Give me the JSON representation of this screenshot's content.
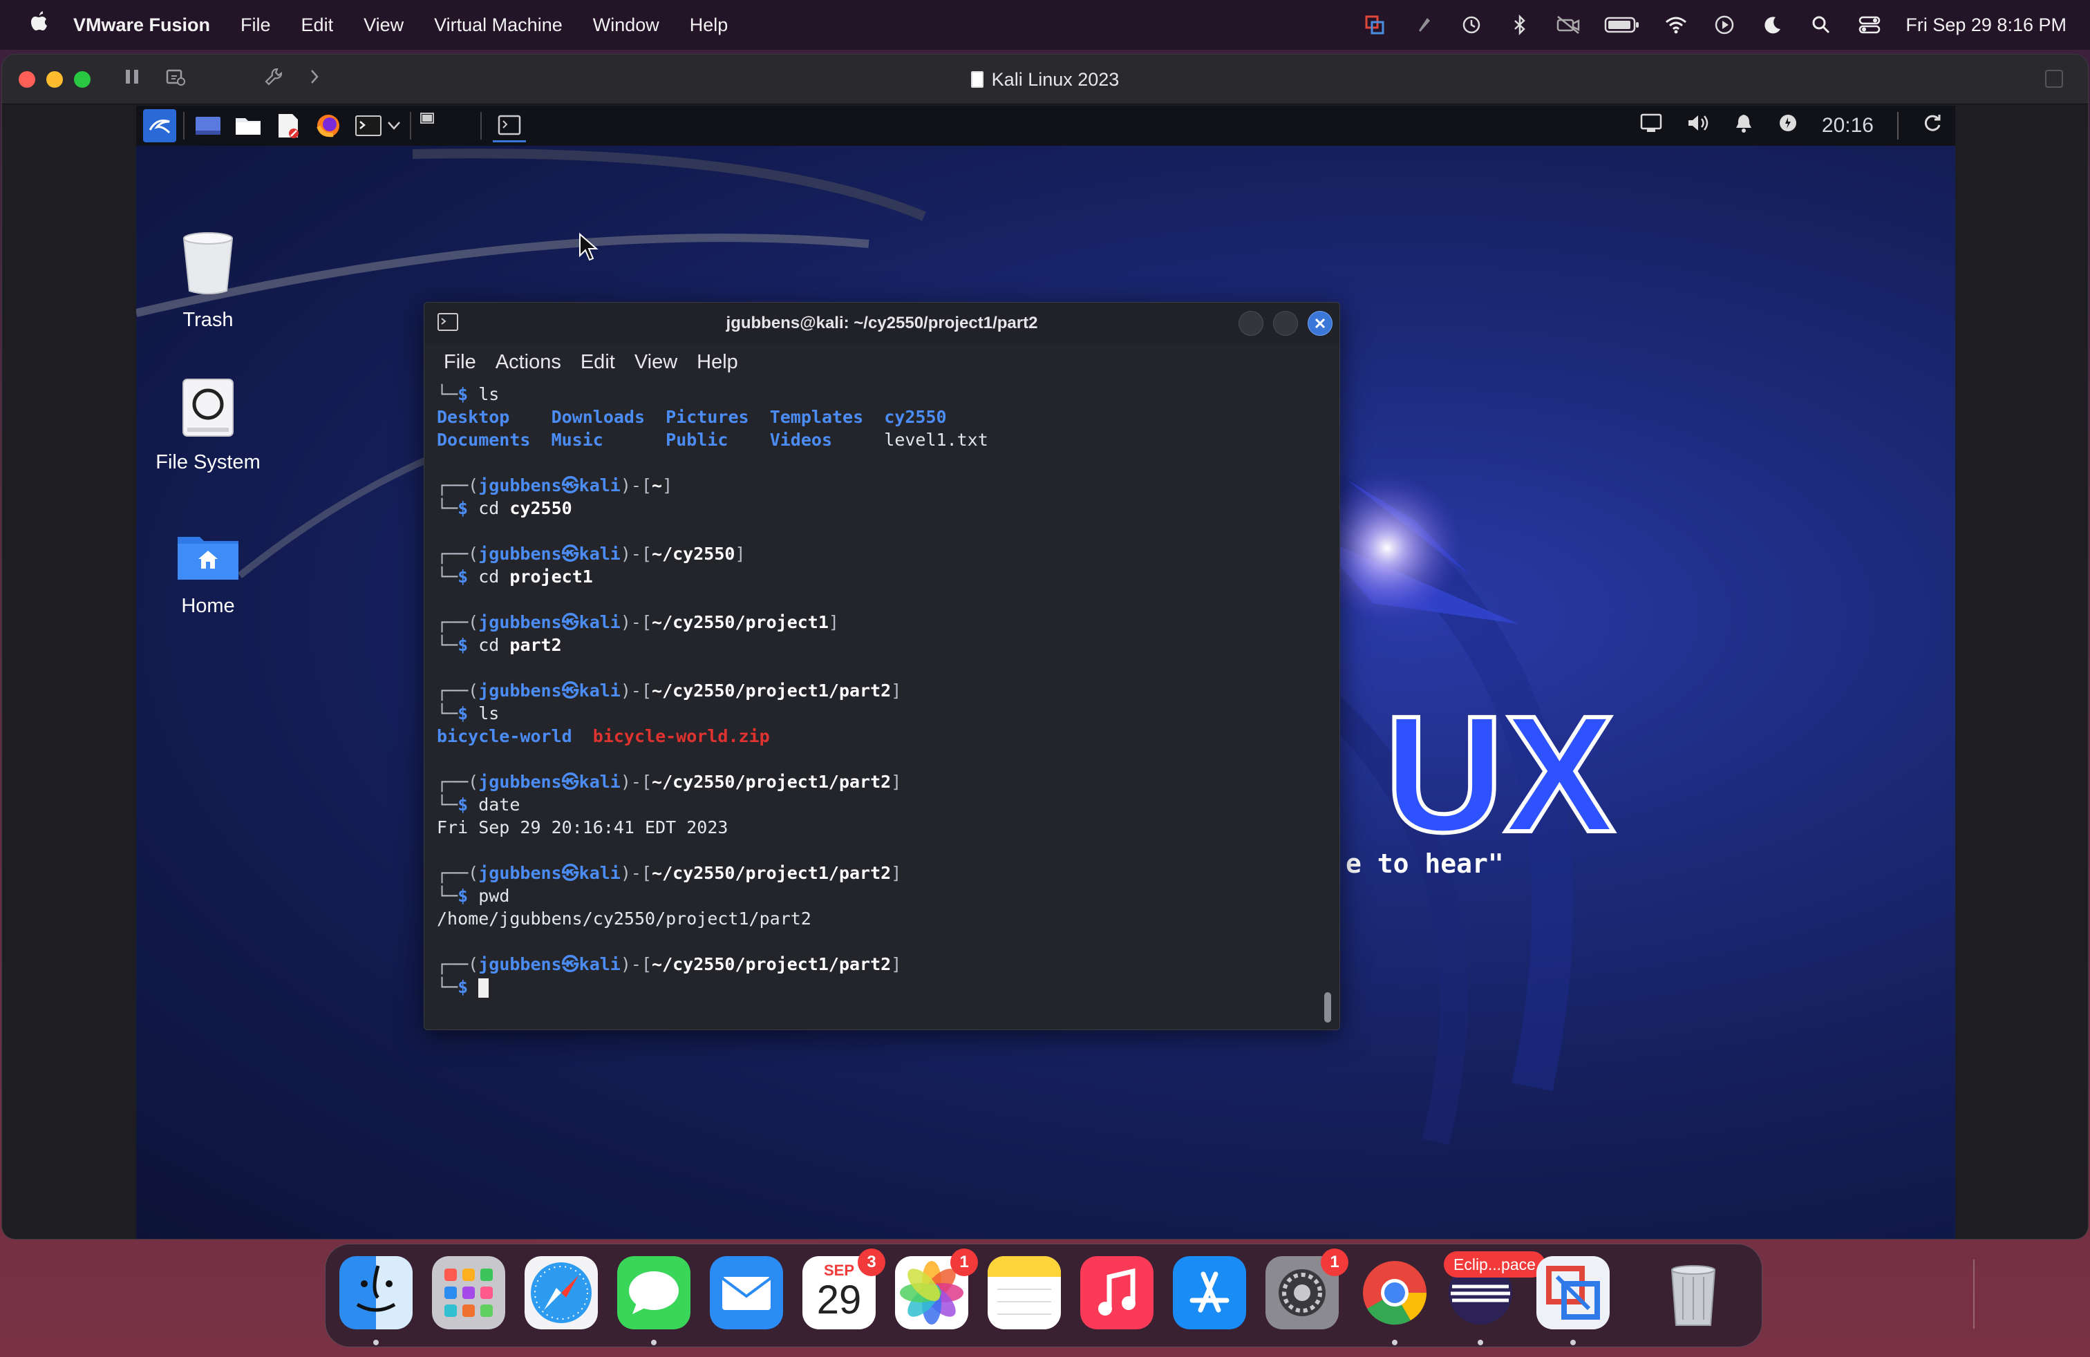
{
  "mac_menubar": {
    "app_name": "VMware Fusion",
    "menus": [
      "File",
      "Edit",
      "View",
      "Virtual Machine",
      "Window",
      "Help"
    ],
    "status_icons": [
      "vmware-status-icon",
      "rocket-icon",
      "time-machine-icon",
      "bluetooth-icon",
      "muted-camera-icon",
      "battery-icon",
      "wifi-icon",
      "now-playing-icon",
      "focus-moon-icon",
      "spotlight-search-icon",
      "control-center-icon"
    ],
    "clock": "Fri Sep 29  8:16 PM"
  },
  "vm_window": {
    "title": "Kali Linux 2023"
  },
  "guest": {
    "panel_clock": "20:16",
    "desktop_icons": [
      {
        "label": "Trash",
        "icon": "trash-icon"
      },
      {
        "label": "File System",
        "icon": "drive-icon"
      },
      {
        "label": "Home",
        "icon": "home-folder-icon"
      }
    ],
    "wallpaper_brand": "KALI LINUX",
    "wallpaper_brand_visible": "UX",
    "wallpaper_quote_visible": "e to hear\"",
    "wallpaper_quote_faded": "become, the more you are able to hear\""
  },
  "terminal": {
    "title": "jgubbens@kali: ~/cy2550/project1/part2",
    "menus": [
      "File",
      "Actions",
      "Edit",
      "View",
      "Help"
    ],
    "user": "jgubbens",
    "host": "kali",
    "first_cmd": "ls",
    "ls_home": [
      [
        "Desktop",
        "Downloads",
        "Pictures",
        "Templates",
        "cy2550"
      ],
      [
        "Documents",
        "Music",
        "Public",
        "Videos",
        "level1.txt"
      ]
    ],
    "blocks": [
      {
        "path": "~",
        "cmd_word": "cd",
        "cmd_arg": "cy2550"
      },
      {
        "path": "~/cy2550",
        "cmd_word": "cd",
        "cmd_arg": "project1"
      },
      {
        "path": "~/cy2550/project1",
        "cmd_word": "cd",
        "cmd_arg": "part2"
      },
      {
        "path": "~/cy2550/project1/part2",
        "cmd_word": "ls",
        "cmd_arg": ""
      },
      {
        "path": "~/cy2550/project1/part2",
        "cmd_word": "date",
        "cmd_arg": ""
      },
      {
        "path": "~/cy2550/project1/part2",
        "cmd_word": "pwd",
        "cmd_arg": ""
      },
      {
        "path": "~/cy2550/project1/part2",
        "cmd_word": "",
        "cmd_arg": ""
      }
    ],
    "ls_part2": {
      "dir": "bicycle-world",
      "zip": "bicycle-world.zip"
    },
    "date_output": "Fri Sep 29 20:16:41 EDT 2023",
    "pwd_output": "/home/jgubbens/cy2550/project1/part2"
  },
  "dock": {
    "calendar_month": "SEP",
    "calendar_day": "29",
    "calendar_badge": "3",
    "photos_badge": "1",
    "settings_badge": "1",
    "eclipse_label": "Eclip...pace"
  }
}
